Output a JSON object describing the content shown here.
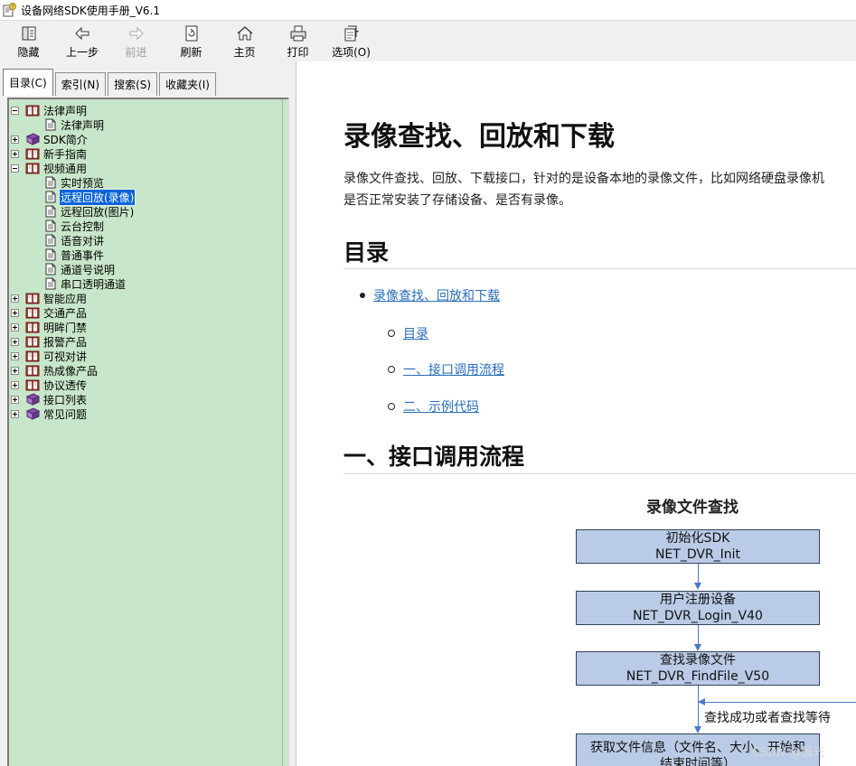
{
  "window": {
    "title": "设备网络SDK使用手册_V6.1"
  },
  "toolbar": {
    "buttons": [
      {
        "label": "隐藏",
        "icon": "hide-panel-icon",
        "enabled": true
      },
      {
        "label": "上一步",
        "icon": "back-arrow-icon",
        "enabled": true
      },
      {
        "label": "前进",
        "icon": "forward-arrow-icon",
        "enabled": false
      },
      {
        "label": "刷新",
        "icon": "refresh-icon",
        "enabled": true
      },
      {
        "label": "主页",
        "icon": "home-icon",
        "enabled": true
      },
      {
        "label": "打印",
        "icon": "print-icon",
        "enabled": true
      },
      {
        "label": "选项(O)",
        "icon": "options-icon",
        "enabled": true
      }
    ]
  },
  "nav": {
    "tabs": [
      {
        "label": "目录(C)",
        "active": true
      },
      {
        "label": "索引(N)",
        "active": false
      },
      {
        "label": "搜索(S)",
        "active": false
      },
      {
        "label": "收藏夹(I)",
        "active": false
      }
    ],
    "tree": [
      {
        "label": "法律声明",
        "level": 0,
        "type": "book-open",
        "expander": "minus"
      },
      {
        "label": "法律声明",
        "level": 1,
        "type": "page"
      },
      {
        "label": "SDK简介",
        "level": 0,
        "type": "book-closed",
        "expander": "plus"
      },
      {
        "label": "新手指南",
        "level": 0,
        "type": "book-open",
        "expander": "plus"
      },
      {
        "label": "视频通用",
        "level": 0,
        "type": "book-open",
        "expander": "minus"
      },
      {
        "label": "实时预览",
        "level": 1,
        "type": "page"
      },
      {
        "label": "远程回放(录像)",
        "level": 1,
        "type": "page",
        "selected": true
      },
      {
        "label": "远程回放(图片)",
        "level": 1,
        "type": "page"
      },
      {
        "label": "云台控制",
        "level": 1,
        "type": "page"
      },
      {
        "label": "语音对讲",
        "level": 1,
        "type": "page"
      },
      {
        "label": "普通事件",
        "level": 1,
        "type": "page"
      },
      {
        "label": "通道号说明",
        "level": 1,
        "type": "page"
      },
      {
        "label": "串口透明通道",
        "level": 1,
        "type": "page"
      },
      {
        "label": "智能应用",
        "level": 0,
        "type": "book-open",
        "expander": "plus"
      },
      {
        "label": "交通产品",
        "level": 0,
        "type": "book-open",
        "expander": "plus"
      },
      {
        "label": "明眸门禁",
        "level": 0,
        "type": "book-open",
        "expander": "plus"
      },
      {
        "label": "报警产品",
        "level": 0,
        "type": "book-open",
        "expander": "plus"
      },
      {
        "label": "可视对讲",
        "level": 0,
        "type": "book-open",
        "expander": "plus"
      },
      {
        "label": "热成像产品",
        "level": 0,
        "type": "book-open",
        "expander": "plus"
      },
      {
        "label": "协议透传",
        "level": 0,
        "type": "book-open",
        "expander": "plus"
      },
      {
        "label": "接口列表",
        "level": 0,
        "type": "book-closed",
        "expander": "plus"
      },
      {
        "label": "常见问题",
        "level": 0,
        "type": "book-closed",
        "expander": "plus"
      }
    ]
  },
  "article": {
    "title": "录像查找、回放和下载",
    "intro": "录像文件查找、回放、下载接口，针对的是设备本地的录像文件，比如网络硬盘录像机",
    "intro_line2": "是否正常安装了存储设备、是否有录像。",
    "toc_heading": "目录",
    "toc": {
      "top": "录像查找、回放和下载",
      "items": [
        "目录",
        "一、接口调用流程",
        "二、示例代码"
      ]
    },
    "section1_heading": "一、接口调用流程",
    "flowchart": {
      "title": "录像文件查找",
      "steps": [
        {
          "line1": "初始化SDK",
          "line2": "NET_DVR_Init"
        },
        {
          "line1": "用户注册设备",
          "line2": "NET_DVR_Login_V40"
        },
        {
          "line1": "查找录像文件",
          "line2": "NET_DVR_FindFile_V50"
        },
        {
          "line1": "获取文件信息（文件名、大小、开始和",
          "line2": "结束时间等）"
        }
      ],
      "loop_note": "查找成功或者查找等待",
      "colors": {
        "box_fill": "#b9cbe6",
        "arrow": "#4a79c6"
      }
    },
    "watermark": "CSDN @晨光"
  }
}
